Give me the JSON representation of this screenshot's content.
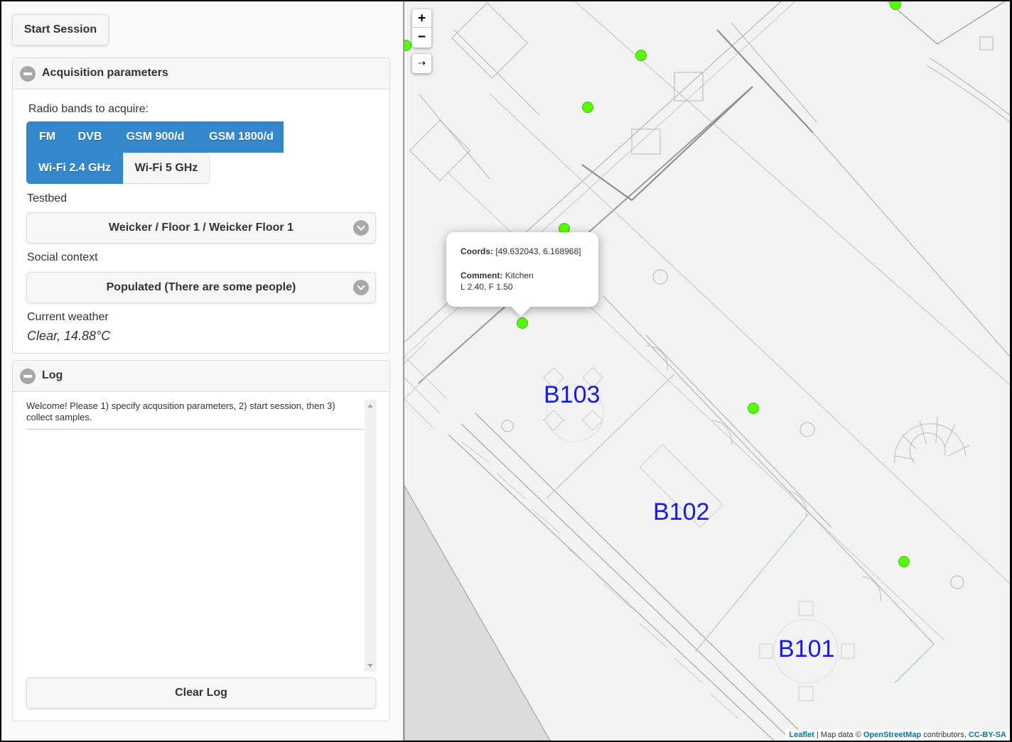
{
  "toolbar": {
    "start_session_label": "Start Session"
  },
  "acquisition": {
    "title": "Acquisition parameters",
    "radio_bands_label": "Radio bands to acquire:",
    "bands": [
      {
        "label": "FM",
        "selected": true
      },
      {
        "label": "DVB",
        "selected": true
      },
      {
        "label": "GSM 900/d",
        "selected": true
      },
      {
        "label": "GSM 1800/d",
        "selected": true
      },
      {
        "label": "Wi-Fi 2.4 GHz",
        "selected": true
      },
      {
        "label": "Wi-Fi 5 GHz",
        "selected": false
      }
    ],
    "testbed_label": "Testbed",
    "testbed_value": "Weicker / Floor 1 / Weicker Floor 1",
    "social_label": "Social context",
    "social_value": "Populated (There are some people)",
    "weather_label": "Current weather",
    "weather_value": "Clear, 14.88°C"
  },
  "log": {
    "title": "Log",
    "text": "Welcome! Please 1) specify acqusition parameters, 2) start session, then 3) collect samples.",
    "clear_label": "Clear Log"
  },
  "map": {
    "zoom_in": "+",
    "zoom_out": "−",
    "arrow_control": "⇢",
    "rooms": [
      "B103",
      "B102",
      "B101"
    ],
    "popup": {
      "coords_label": "Coords:",
      "coords_value": "[49.632043, 6.168968]",
      "comment_label": "Comment:",
      "comment_value": "Kitchen",
      "extra": "L 2.40, F 1.50"
    },
    "attribution": {
      "leaflet": "Leaflet",
      "sep": " | Map data © ",
      "osm": "OpenStreetMap",
      "contrib": " contributors, ",
      "license": "CC-BY-SA"
    },
    "marker_color": "#55ff00",
    "room_label_color": "#1a1ae6"
  },
  "colors": {
    "accent": "#3388cc"
  }
}
